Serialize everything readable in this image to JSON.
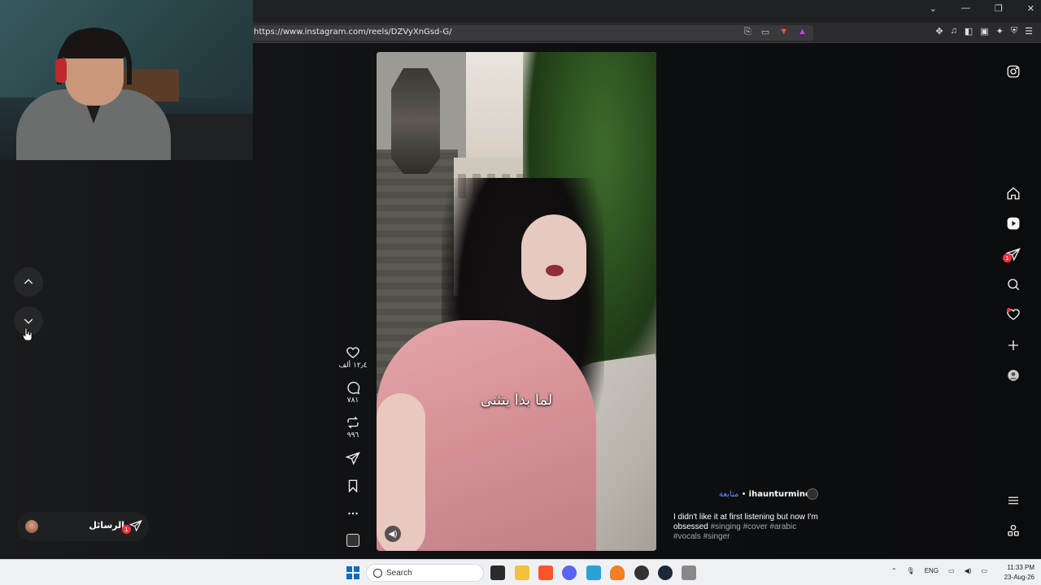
{
  "browser": {
    "url": "https://www.instagram.com/reels/DZVyXnGsd-G/",
    "window_controls": [
      "⌄",
      "—",
      "❐",
      "✕"
    ]
  },
  "reel": {
    "caption_overlay": "لما بدا يتثنى",
    "likes": "١٢٫٤ ألف",
    "comments": "٧٨١",
    "reposts": "٩٩٦"
  },
  "post": {
    "username": "ihaunturmind",
    "separator": "•",
    "follow_label": "متابعة",
    "description": "I didn't like it at first listening but now I'm obsessed",
    "hashtags": "#singing #cover #arabic #vocals #singer"
  },
  "messages": {
    "label": "الرسائل",
    "badge": "1"
  },
  "rail": {
    "messages_badge": "1"
  },
  "taskbar": {
    "search_placeholder": "Search",
    "language": "ENG",
    "time": "11:33 PM",
    "date": "23-Aug-26"
  },
  "colors": {
    "accent_link": "#6c8cff",
    "badge": "#ff3040"
  }
}
